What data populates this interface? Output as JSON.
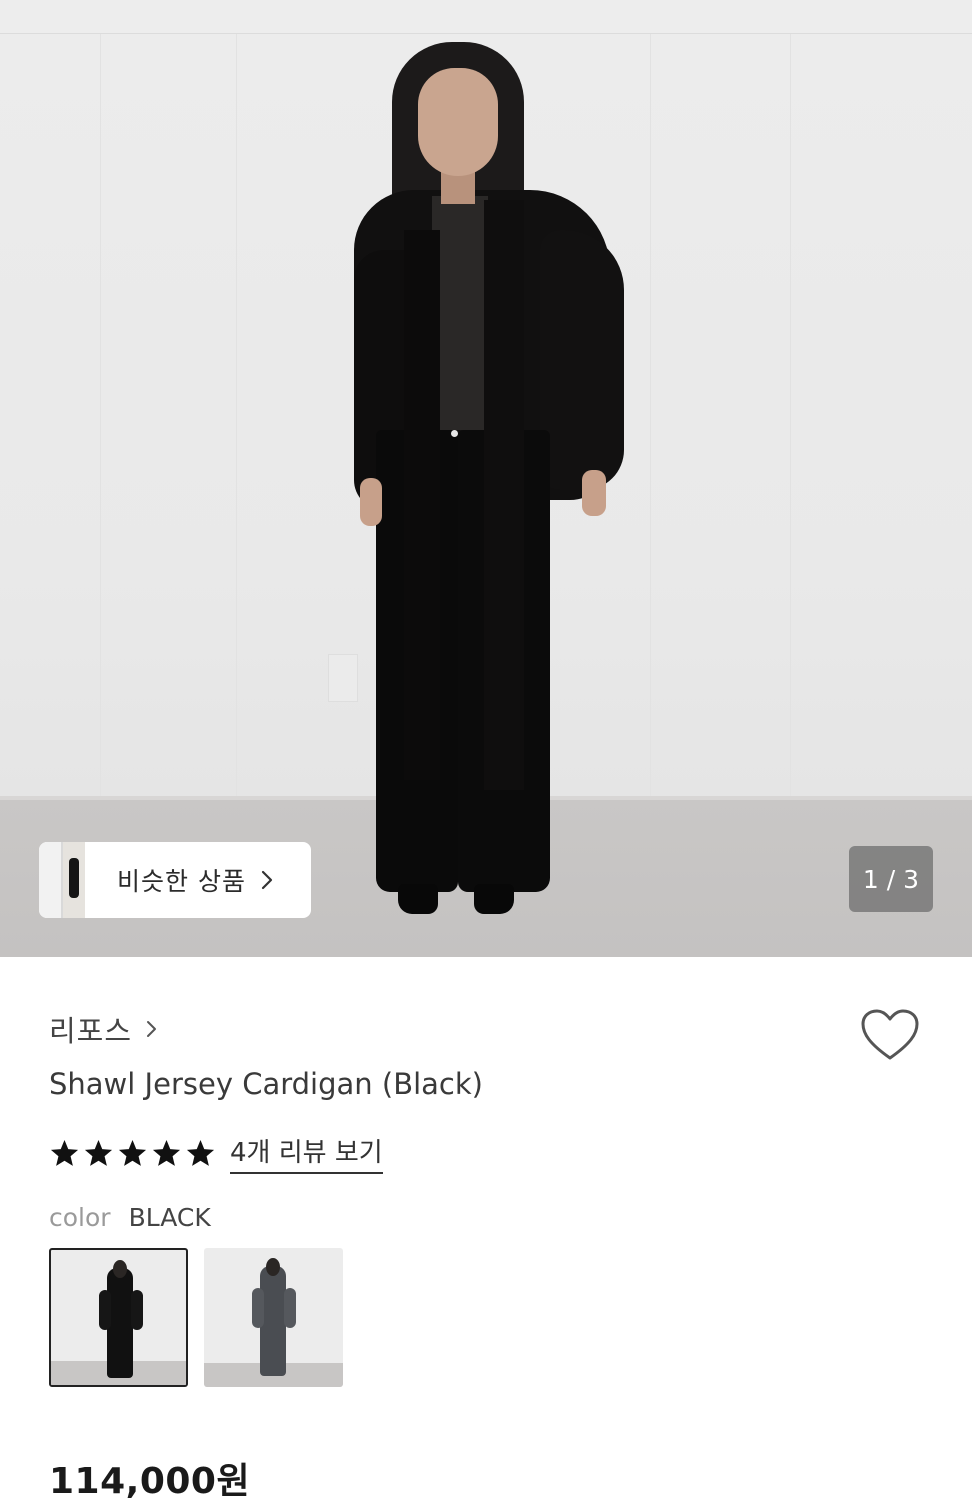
{
  "gallery": {
    "counter": "1 / 3",
    "similar_label": "비슷한 상품"
  },
  "product": {
    "brand": "리포스",
    "title": "Shawl Jersey Cardigan (Black)",
    "rating_stars": 5,
    "review_link": "4개 리뷰 보기",
    "color_key": "color",
    "color_value": "BLACK",
    "swatches": [
      {
        "color": "#111111",
        "selected": true
      },
      {
        "color": "#4a4d52",
        "selected": false
      }
    ],
    "price": "114,000원"
  },
  "colors": {
    "star": "#111111",
    "selected_border": "#222222"
  },
  "icons": {
    "heart": "heart-icon",
    "chevron": "chevron-right-icon",
    "star": "star-icon"
  }
}
